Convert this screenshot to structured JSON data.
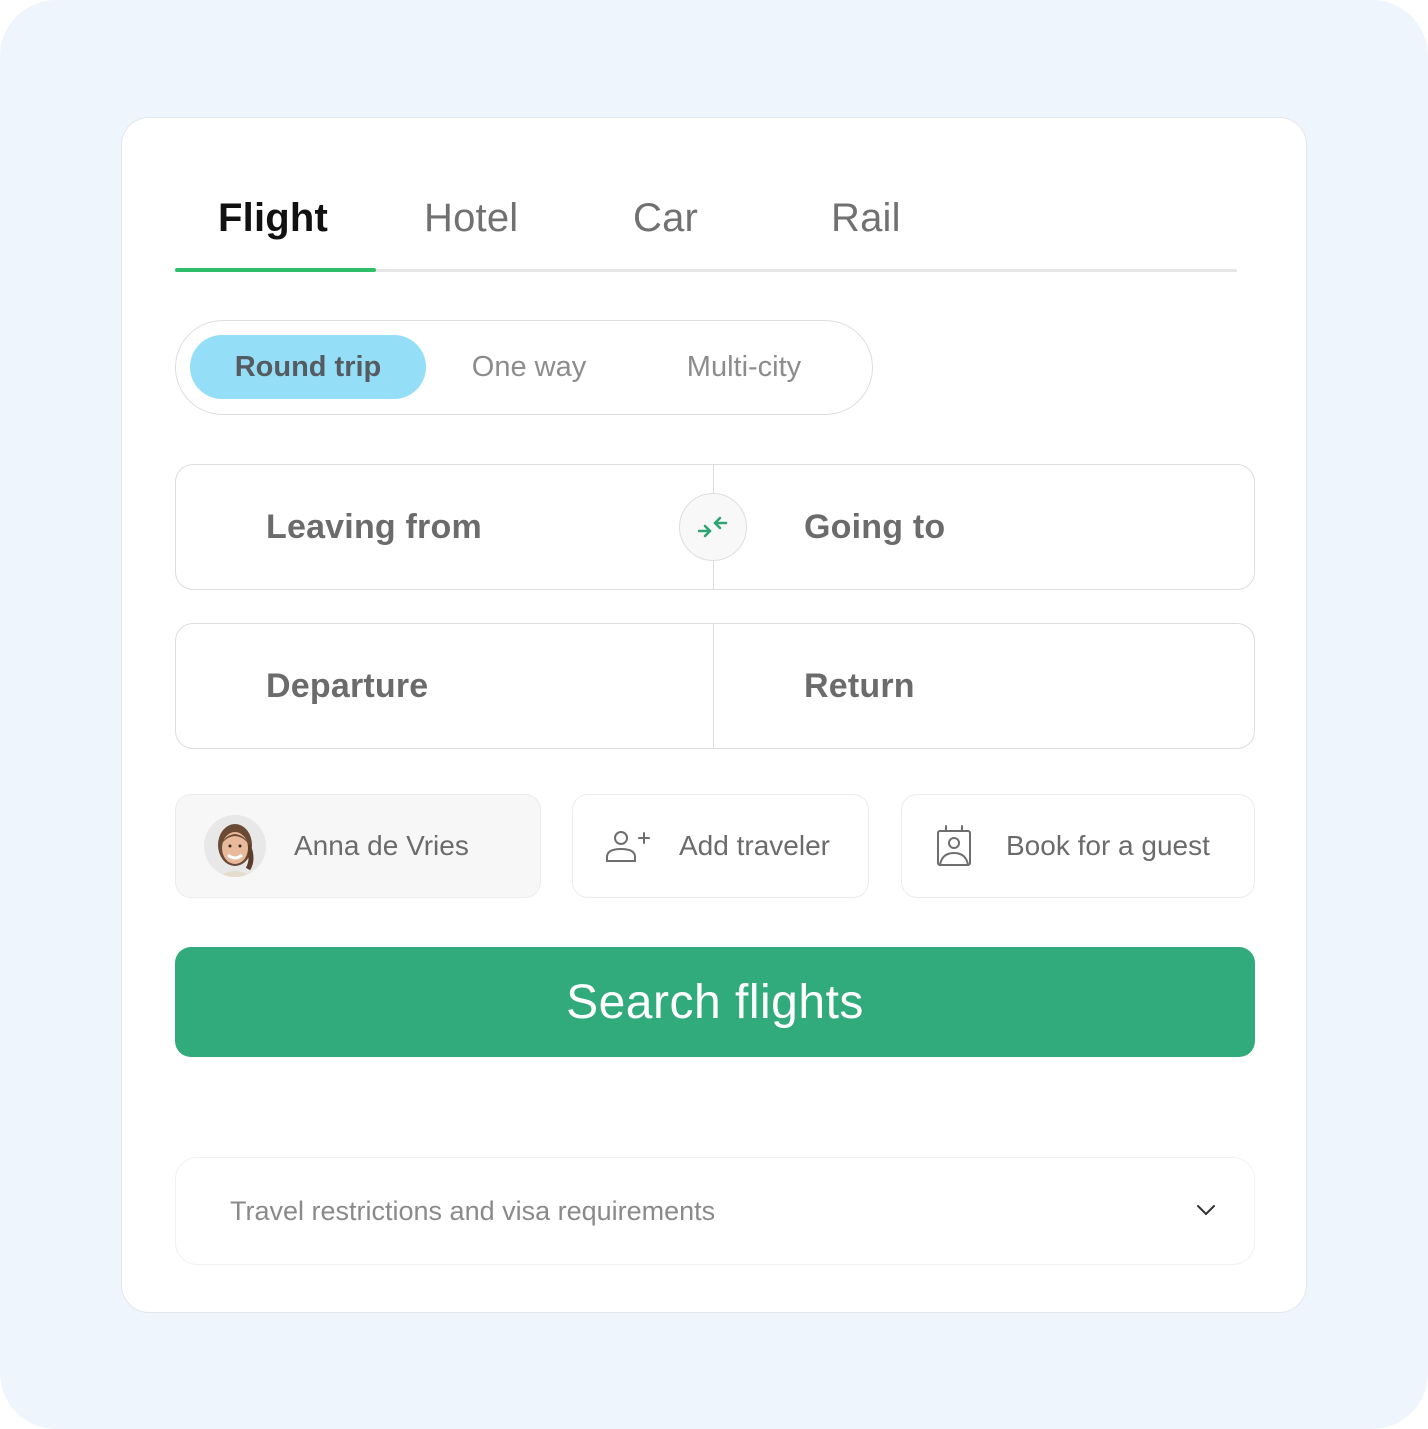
{
  "tabs": [
    {
      "label": "Flight",
      "active": true
    },
    {
      "label": "Hotel",
      "active": false
    },
    {
      "label": "Car",
      "active": false
    },
    {
      "label": "Rail",
      "active": false
    }
  ],
  "trip_type": {
    "options": [
      {
        "label": "Round trip",
        "selected": true
      },
      {
        "label": "One way",
        "selected": false
      },
      {
        "label": "Multi-city",
        "selected": false
      }
    ]
  },
  "route": {
    "origin_placeholder": "Leaving from",
    "destination_placeholder": "Going to",
    "swap_icon": "swap-arrows-icon"
  },
  "dates": {
    "departure_placeholder": "Departure",
    "return_placeholder": "Return"
  },
  "travelers": {
    "current_user": {
      "name": "Anna de Vries",
      "icon": "avatar-photo"
    },
    "add_traveler": {
      "label": "Add traveler",
      "icon": "user-plus-icon"
    },
    "book_for_guest": {
      "label": "Book for a guest",
      "icon": "guest-badge-icon"
    }
  },
  "actions": {
    "search_label": "Search flights"
  },
  "info": {
    "restrictions_label": "Travel restrictions and visa requirements",
    "expand_icon": "chevron-down-icon"
  },
  "colors": {
    "accent_green": "#31ab7b",
    "tab_indicator": "#2fbf6a",
    "selected_pill": "#94def8",
    "page_background": "#eff5fc"
  }
}
